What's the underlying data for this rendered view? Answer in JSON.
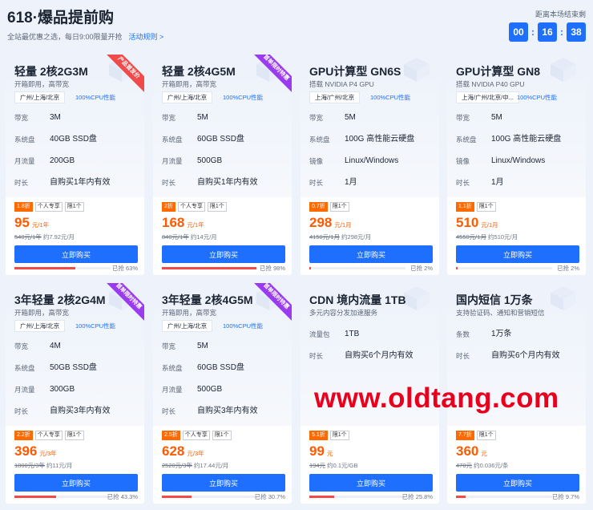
{
  "header": {
    "title": "618·爆品提前购",
    "subtitle": "全站最优惠之选，每日9:00限量开抢",
    "rules_link": "活动规则 >",
    "countdown_label": "距离本场结束剩",
    "countdown": {
      "h": "00",
      "m": "16",
      "s": "38"
    }
  },
  "cards": [
    {
      "title": "轻量 2核2G3M",
      "subtitle": "开箱即用，高带宽",
      "region": "广州/上海/北京",
      "cpu": "100%CPU性能",
      "ribbon": "产品首发价",
      "ribbon_color": "red",
      "specs": [
        {
          "k": "带宽",
          "v": "3M"
        },
        {
          "k": "系统盘",
          "v": "40GB SSD盘"
        },
        {
          "k": "月流量",
          "v": "200GB"
        },
        {
          "k": "时长",
          "v": "自购买1年内有效"
        }
      ],
      "discount": "1.8折",
      "tags": [
        "个人专享",
        "限1个"
      ],
      "price": "95",
      "unit": "元/1年",
      "orig": "540元/1年",
      "per": "约7.92元/月",
      "buy": "立即购买",
      "sold": "已抢 63%",
      "sold_pct": 63
    },
    {
      "title": "轻量 2核4G5M",
      "subtitle": "开箱即用，高带宽",
      "region": "广州/上海/北京",
      "cpu": "100%CPU性能",
      "ribbon": "首单限时特惠",
      "ribbon_color": "purple",
      "specs": [
        {
          "k": "带宽",
          "v": "5M"
        },
        {
          "k": "系统盘",
          "v": "60GB SSD盘"
        },
        {
          "k": "月流量",
          "v": "500GB"
        },
        {
          "k": "时长",
          "v": "自购买1年内有效"
        }
      ],
      "discount": "2折",
      "tags": [
        "个人专享",
        "限1个"
      ],
      "price": "168",
      "unit": "元/1年",
      "orig": "840元/1年",
      "per": "约14元/月",
      "buy": "立即购买",
      "sold": "已抢 98%",
      "sold_pct": 98
    },
    {
      "title": "GPU计算型 GN6S",
      "subtitle": "搭载 NVIDIA P4 GPU",
      "region": "上海/广州/北京",
      "cpu": "100%CPU性能",
      "ribbon": "",
      "ribbon_color": "",
      "specs": [
        {
          "k": "带宽",
          "v": "5M"
        },
        {
          "k": "系统盘",
          "v": "100G 高性能云硬盘"
        },
        {
          "k": "镜像",
          "v": "Linux/Windows"
        },
        {
          "k": "时长",
          "v": "1月"
        }
      ],
      "discount": "0.7折",
      "tags": [
        "限1个"
      ],
      "price": "298",
      "unit": "元/1月",
      "orig": "4150元/1月",
      "per": "约298元/月",
      "buy": "立即购买",
      "sold": "已抢 2%",
      "sold_pct": 2
    },
    {
      "title": "GPU计算型 GN8",
      "subtitle": "搭载 NVIDIA P40 GPU",
      "region": "上海/广州/北京/中...",
      "cpu": "100%CPU性能",
      "ribbon": "",
      "ribbon_color": "",
      "specs": [
        {
          "k": "带宽",
          "v": "5M"
        },
        {
          "k": "系统盘",
          "v": "100G 高性能云硬盘"
        },
        {
          "k": "镜像",
          "v": "Linux/Windows"
        },
        {
          "k": "时长",
          "v": "1月"
        }
      ],
      "discount": "1.1折",
      "tags": [
        "限1个"
      ],
      "price": "510",
      "unit": "元/1月",
      "orig": "4550元/1月",
      "per": "约510元/月",
      "buy": "立即购买",
      "sold": "已抢 2%",
      "sold_pct": 2
    },
    {
      "title": "3年轻量 2核2G4M",
      "subtitle": "开箱即用，高带宽",
      "region": "广州/上海/北京",
      "cpu": "100%CPU性能",
      "ribbon": "首单限时特惠",
      "ribbon_color": "purple",
      "specs": [
        {
          "k": "带宽",
          "v": "4M"
        },
        {
          "k": "系统盘",
          "v": "50GB SSD盘"
        },
        {
          "k": "月流量",
          "v": "300GB"
        },
        {
          "k": "时长",
          "v": "自购买3年内有效"
        }
      ],
      "discount": "2.2折",
      "tags": [
        "个人专享",
        "限1个"
      ],
      "price": "396",
      "unit": "元/3年",
      "orig": "1800元/3年",
      "per": "约11元/月",
      "buy": "立即购买",
      "sold": "已抢 43.3%",
      "sold_pct": 43.3
    },
    {
      "title": "3年轻量 2核4G5M",
      "subtitle": "开箱即用，高带宽",
      "region": "广州/上海/北京",
      "cpu": "100%CPU性能",
      "ribbon": "首单限时特惠",
      "ribbon_color": "purple",
      "specs": [
        {
          "k": "带宽",
          "v": "5M"
        },
        {
          "k": "系统盘",
          "v": "60GB SSD盘"
        },
        {
          "k": "月流量",
          "v": "500GB"
        },
        {
          "k": "时长",
          "v": "自购买3年内有效"
        }
      ],
      "discount": "2.5折",
      "tags": [
        "个人专享",
        "限1个"
      ],
      "price": "628",
      "unit": "元/3年",
      "orig": "2520元/3年",
      "per": "约17.44元/月",
      "buy": "立即购买",
      "sold": "已抢 30.7%",
      "sold_pct": 30.7
    },
    {
      "title": "CDN 境内流量 1TB",
      "subtitle": "多元内容分发加速服务",
      "region": "",
      "cpu": "",
      "ribbon": "",
      "ribbon_color": "",
      "specs": [
        {
          "k": "流量包",
          "v": "1TB"
        },
        {
          "k": "时长",
          "v": "自购买6个月内有效"
        }
      ],
      "discount": "5.1折",
      "tags": [
        "限1个"
      ],
      "price": "99",
      "unit": "元",
      "orig": "194元",
      "per": "约0.1元/GB",
      "buy": "立即购买",
      "sold": "已抢 25.8%",
      "sold_pct": 25.8
    },
    {
      "title": "国内短信 1万条",
      "subtitle": "支持验证码、通知和营销短信",
      "region": "",
      "cpu": "",
      "ribbon": "",
      "ribbon_color": "",
      "specs": [
        {
          "k": "条数",
          "v": "1万条"
        },
        {
          "k": "时长",
          "v": "自购买6个月内有效"
        }
      ],
      "discount": "7.7折",
      "tags": [
        "限1个"
      ],
      "price": "360",
      "unit": "元",
      "orig": "470元",
      "per": "约0.036元/条",
      "buy": "立即购买",
      "sold": "已抢 9.7%",
      "sold_pct": 9.7
    }
  ],
  "watermark": "www.oldtang.com"
}
